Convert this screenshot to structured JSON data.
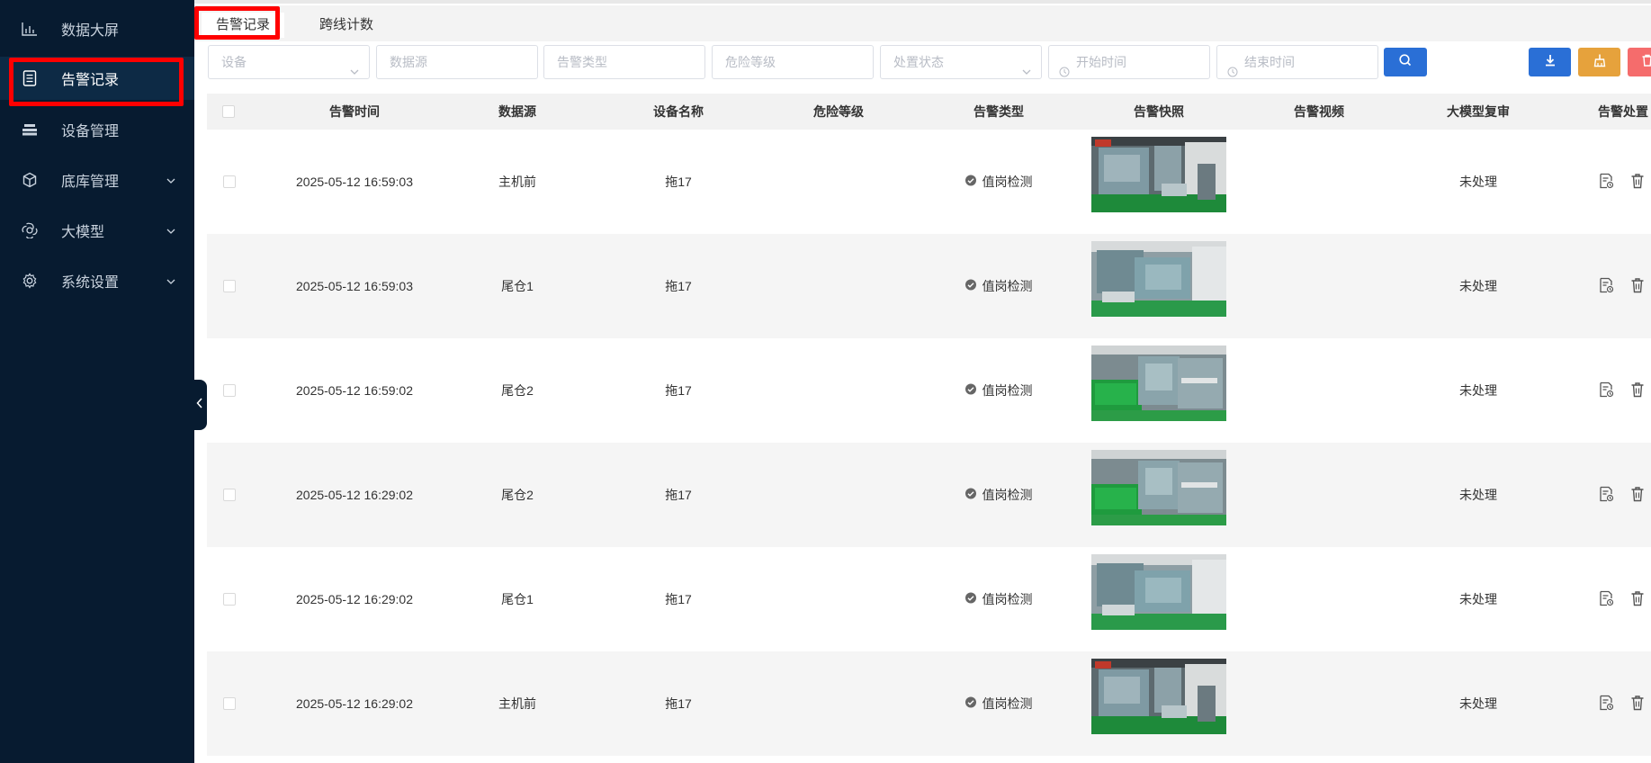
{
  "sidebar": {
    "items": [
      {
        "label": "数据大屏",
        "icon": "chart-icon",
        "expandable": false
      },
      {
        "label": "告警记录",
        "icon": "document-icon",
        "expandable": false,
        "active": true
      },
      {
        "label": "设备管理",
        "icon": "device-stack-icon",
        "expandable": false
      },
      {
        "label": "底库管理",
        "icon": "cube-icon",
        "expandable": true
      },
      {
        "label": "大模型",
        "icon": "ai-model-icon",
        "expandable": true
      },
      {
        "label": "系统设置",
        "icon": "gear-icon",
        "expandable": true
      }
    ]
  },
  "tabs": [
    {
      "label": "告警记录",
      "active": true
    },
    {
      "label": "跨线计数",
      "active": false
    }
  ],
  "filters": {
    "device": "设备",
    "source": "数据源",
    "alarm_type": "告警类型",
    "danger_level": "危险等级",
    "handle_status": "处置状态",
    "start_time": "开始时间",
    "end_time": "结束时间"
  },
  "colors": {
    "sidebar_bg": "#071b30",
    "primary": "#2a6fd6",
    "warning": "#e6a23c",
    "danger": "#f56c6c",
    "highlight": "#ff0000"
  },
  "table": {
    "columns": [
      "告警时间",
      "数据源",
      "设备名称",
      "危险等级",
      "告警类型",
      "告警快照",
      "告警视频",
      "大模型复审",
      "告警处置"
    ],
    "rows": [
      {
        "time": "2025-05-12 16:59:03",
        "source": "主机前",
        "device": "拖17",
        "danger": "",
        "type": "值岗检测",
        "review": "未处理",
        "snapshot_variant": "a"
      },
      {
        "time": "2025-05-12 16:59:03",
        "source": "尾仓1",
        "device": "拖17",
        "danger": "",
        "type": "值岗检测",
        "review": "未处理",
        "snapshot_variant": "b"
      },
      {
        "time": "2025-05-12 16:59:02",
        "source": "尾仓2",
        "device": "拖17",
        "danger": "",
        "type": "值岗检测",
        "review": "未处理",
        "snapshot_variant": "c"
      },
      {
        "time": "2025-05-12 16:29:02",
        "source": "尾仓2",
        "device": "拖17",
        "danger": "",
        "type": "值岗检测",
        "review": "未处理",
        "snapshot_variant": "c"
      },
      {
        "time": "2025-05-12 16:29:02",
        "source": "尾仓1",
        "device": "拖17",
        "danger": "",
        "type": "值岗检测",
        "review": "未处理",
        "snapshot_variant": "b"
      },
      {
        "time": "2025-05-12 16:29:02",
        "source": "主机前",
        "device": "拖17",
        "danger": "",
        "type": "值岗检测",
        "review": "未处理",
        "snapshot_variant": "a"
      }
    ]
  }
}
